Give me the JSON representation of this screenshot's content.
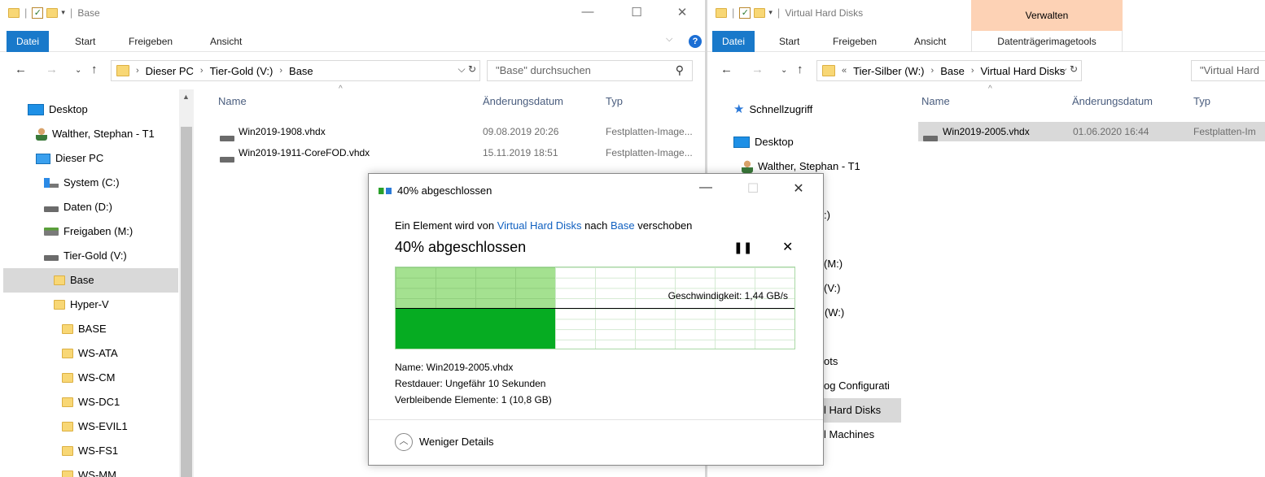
{
  "left": {
    "title": "Base",
    "ribbon": {
      "file": "Datei",
      "tabs": [
        "Start",
        "Freigeben",
        "Ansicht"
      ]
    },
    "address": {
      "crumbs": [
        "Dieser PC",
        "Tier-Gold (V:)",
        "Base"
      ]
    },
    "search_placeholder": "\"Base\" durchsuchen",
    "tree": [
      {
        "label": "Desktop",
        "icon": "desktop-icon"
      },
      {
        "label": "Walther, Stephan - T1",
        "icon": "user-icon"
      },
      {
        "label": "Dieser PC",
        "icon": "computer-icon"
      },
      {
        "label": "System (C:)",
        "icon": "system-drive-icon"
      },
      {
        "label": "Daten (D:)",
        "icon": "drive-icon"
      },
      {
        "label": "Freigaben (M:)",
        "icon": "network-drive-icon"
      },
      {
        "label": "Tier-Gold (V:)",
        "icon": "drive-icon"
      },
      {
        "label": "Base",
        "icon": "folder-icon",
        "selected": true
      },
      {
        "label": "Hyper-V",
        "icon": "folder-icon"
      },
      {
        "label": "BASE",
        "icon": "folder-icon"
      },
      {
        "label": "WS-ATA",
        "icon": "folder-icon"
      },
      {
        "label": "WS-CM",
        "icon": "folder-icon"
      },
      {
        "label": "WS-DC1",
        "icon": "folder-icon"
      },
      {
        "label": "WS-EVIL1",
        "icon": "folder-icon"
      },
      {
        "label": "WS-FS1",
        "icon": "folder-icon"
      },
      {
        "label": "WS-MM",
        "icon": "folder-icon"
      }
    ],
    "columns": {
      "name": "Name",
      "date": "Änderungsdatum",
      "type": "Typ"
    },
    "files": [
      {
        "name": "Win2019-1908.vhdx",
        "date": "09.08.2019 20:26",
        "type": "Festplatten-Image..."
      },
      {
        "name": "Win2019-1911-CoreFOD.vhdx",
        "date": "15.11.2019 18:51",
        "type": "Festplatten-Image..."
      }
    ]
  },
  "right": {
    "title": "Virtual Hard Disks",
    "context_tab": "Verwalten",
    "ribbon": {
      "file": "Datei",
      "tabs": [
        "Start",
        "Freigeben",
        "Ansicht",
        "Datenträgerimagetools"
      ]
    },
    "address": {
      "prefix": "«",
      "crumbs": [
        "Tier-Silber (W:)",
        "Base",
        "Virtual Hard Disks"
      ]
    },
    "search_placeholder": "\"Virtual Hard",
    "tree_quick": "Schnellzugriff",
    "tree_desktop": "Desktop",
    "tree_user": "Walther, Stephan - T1",
    "tree_partial": [
      ":)",
      "(M:)",
      "(V:)",
      "r (W:)",
      "ots",
      "og Configurati",
      "l Hard Disks",
      "l Machines"
    ],
    "columns": {
      "name": "Name",
      "date": "Änderungsdatum",
      "type": "Typ"
    },
    "files": [
      {
        "name": "Win2019-2005.vhdx",
        "date": "01.06.2020 16:44",
        "type": "Festplatten-Im"
      }
    ]
  },
  "dialog": {
    "title": "40% abgeschlossen",
    "msg_prefix": "Ein Element wird von ",
    "msg_src": "Virtual Hard Disks",
    "msg_mid": " nach ",
    "msg_dst": "Base",
    "msg_suffix": " verschoben",
    "percent_label": "40% abgeschlossen",
    "progress": 0.4,
    "speed_label": "Geschwindigkeit: 1,44 GB/s",
    "name_line": "Name:  Win2019-2005.vhdx",
    "remaining_time": "Restdauer:  Ungefähr 10 Sekunden",
    "remaining_items": "Verbleibende Elemente:  1 (10,8 GB)",
    "fewer_details": "Weniger Details"
  },
  "colors": {
    "file_tab": "#1979ca",
    "context_band": "#fdd2b5",
    "progress_dark": "#06ac22",
    "progress_light": "#a4e190",
    "link": "#1060c0"
  }
}
